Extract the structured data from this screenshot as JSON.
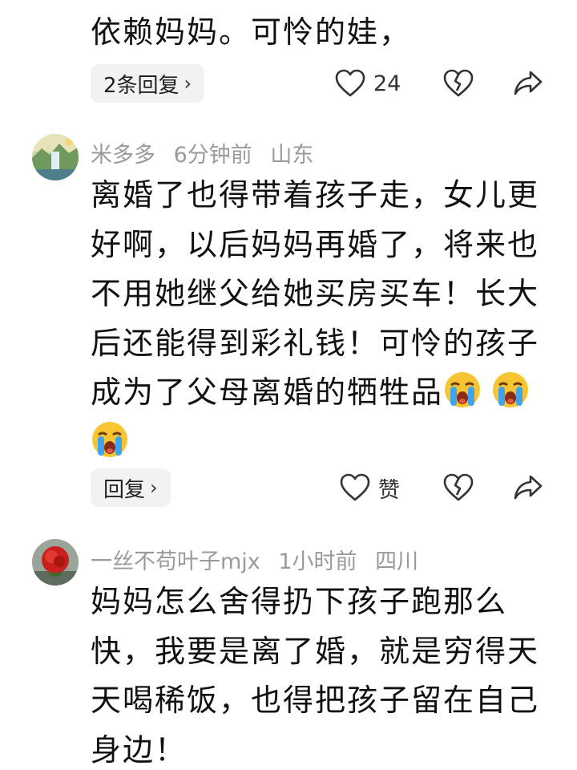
{
  "comments": [
    {
      "partial_text": "依赖妈妈。可怜的娃，",
      "reply_label": "2条回复",
      "like_count": "24"
    },
    {
      "username": "米多多",
      "time": "6分钟前",
      "location": "山东",
      "text": "离婚了也得带着孩子走，女儿更好啊，以后妈妈再婚了，将来也不用她继父给她买房买车！长大后还能得到彩礼钱！可怜的孩子成为了父母离婚的牺牲品",
      "emoji_count": 3,
      "reply_label": "回复",
      "like_label": "赞"
    },
    {
      "username": "一丝不苟叶子mjx",
      "time": "1小时前",
      "location": "四川",
      "text": "妈妈怎么舍得扔下孩子跑那么快，我要是离了婚，就是穷得天天喝稀饭，也得把孩子留在自己身边！"
    }
  ],
  "icons": {
    "like": "heart-outline-icon",
    "dislike": "broken-heart-icon",
    "share": "share-arrow-icon",
    "emoji": "crying-face-emoji"
  },
  "colors": {
    "meta_text": "#9a9a9a",
    "pill_bg": "#f2f2f2",
    "body_text": "#111111"
  }
}
